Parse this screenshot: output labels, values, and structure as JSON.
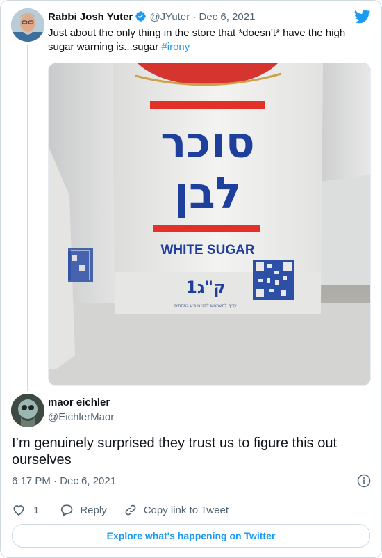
{
  "original_tweet": {
    "author_name": "Rabbi Josh Yuter",
    "handle_and_date": "@JYuter · Dec 6, 2021",
    "text_main": "Just about the only thing in the store that *doesn't* have the high sugar warning is...sugar ",
    "hashtag": "#irony",
    "photo": {
      "package_text_hebrew_line1": "סוכר",
      "package_text_hebrew_line2": "לבן",
      "package_text_english": "WHITE SUGAR",
      "package_weight": "1ק\"ג",
      "package_small_print": "עדיף להשתמש לפני מופיע בתחתית"
    }
  },
  "reply": {
    "author_name": "maor eichler",
    "handle": "@EichlerMaor",
    "text": "I’m genuinely surprised they trust us to figure this out ourselves",
    "timestamp": "6:17 PM · Dec 6, 2021"
  },
  "actions": {
    "like_count": "1",
    "reply_label": "Reply",
    "copy_link_label": "Copy link to Tweet"
  },
  "explore_label": "Explore what's happening on Twitter",
  "colors": {
    "accent": "#1d9bf0",
    "text": "#0f1419",
    "muted": "#536471",
    "border": "#cfd9de"
  }
}
